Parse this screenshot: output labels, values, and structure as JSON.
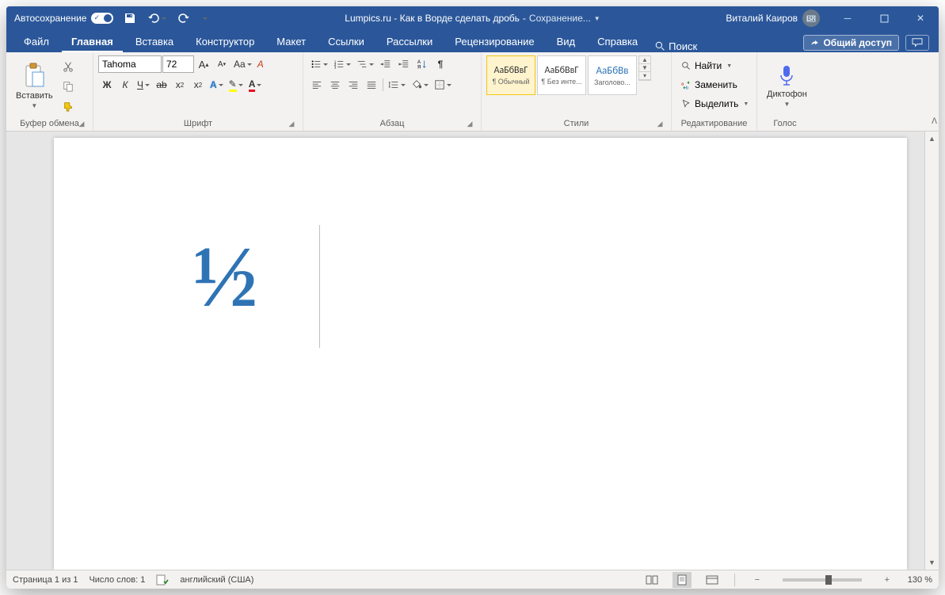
{
  "titlebar": {
    "autosave": "Автосохранение",
    "document_title": "Lumpics.ru - Как в Ворде сделать дробь",
    "save_status": "Сохранение...",
    "user_name": "Виталий Каиров",
    "user_initials": "ВК"
  },
  "tabs": {
    "file": "Файл",
    "home": "Главная",
    "insert": "Вставка",
    "design": "Конструктор",
    "layout": "Макет",
    "references": "Ссылки",
    "mailings": "Рассылки",
    "review": "Рецензирование",
    "view": "Вид",
    "help": "Справка",
    "search": "Поиск",
    "share": "Общий доступ"
  },
  "ribbon": {
    "clipboard": {
      "label": "Буфер обмена",
      "paste": "Вставить"
    },
    "font": {
      "label": "Шрифт",
      "name": "Tahoma",
      "size": "72",
      "bold": "Ж",
      "italic": "К",
      "underline": "Ч",
      "strike": "ab",
      "sub": "x₂",
      "sup": "x²",
      "caseAa": "Aa"
    },
    "paragraph": {
      "label": "Абзац"
    },
    "styles": {
      "label": "Стили",
      "items": [
        {
          "preview": "АаБбВвГ",
          "name": "¶ Обычный"
        },
        {
          "preview": "АаБбВвГ",
          "name": "¶ Без инте..."
        },
        {
          "preview": "АаБбВв",
          "name": "Заголово..."
        }
      ]
    },
    "editing": {
      "label": "Редактирование",
      "find": "Найти",
      "replace": "Заменить",
      "select": "Выделить"
    },
    "voice": {
      "label": "Голос",
      "dictate": "Диктофон"
    }
  },
  "document": {
    "content": "½"
  },
  "statusbar": {
    "page": "Страница 1 из 1",
    "words": "Число слов: 1",
    "language": "английский (США)",
    "zoom": "130 %"
  }
}
